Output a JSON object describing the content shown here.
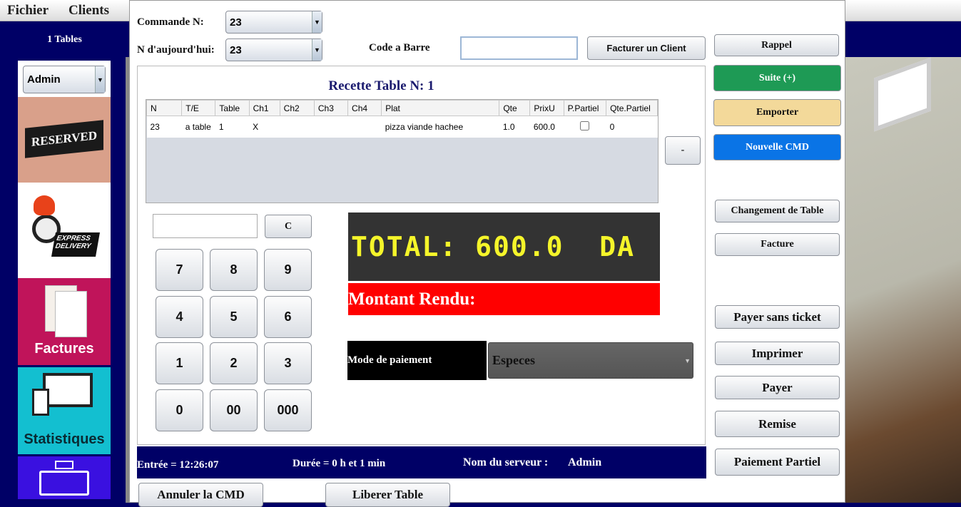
{
  "menu": {
    "items": [
      "Fichier",
      "Clients"
    ]
  },
  "sidebar": {
    "tables_label": "1 Tables",
    "user_select": "Admin",
    "tiles": [
      {
        "label": "RESERVED"
      },
      {
        "label": "EXPRESS DELIVERY"
      },
      {
        "label": "Factures"
      },
      {
        "label": "Statistiques"
      },
      {
        "label": ""
      }
    ]
  },
  "header": {
    "commande_label": "Commande N:",
    "commande_value": "23",
    "today_label": "N d'aujourd'hui:",
    "today_value": "23",
    "barcode_label": "Code a Barre",
    "barcode_value": "",
    "invoice_client": "Facturer un Client"
  },
  "recette": {
    "title": "Recette Table N: 1",
    "columns": [
      "N",
      "T/E",
      "Table",
      "Ch1",
      "Ch2",
      "Ch3",
      "Ch4",
      "Plat",
      "Qte",
      "PrixU",
      "P.Partiel",
      "Qte.Partiel"
    ],
    "rows": [
      {
        "n": "23",
        "te": "a table",
        "table": "1",
        "ch1": "X",
        "ch2": "",
        "ch3": "",
        "ch4": "",
        "plat": "pizza viande hachee",
        "qte": "1.0",
        "prixu": "600.0",
        "ppartiel": false,
        "qtepartiel": "0"
      }
    ],
    "minus": "-"
  },
  "keypad": {
    "input": "",
    "clear": "C",
    "keys": [
      "7",
      "8",
      "9",
      "4",
      "5",
      "6",
      "1",
      "2",
      "3",
      "0",
      "00",
      "000"
    ]
  },
  "total": {
    "text": "TOTAL: 600.0  DA",
    "color": "#f5f52a"
  },
  "rendu": {
    "text": "Montant Rendu:",
    "color": "#ff0000"
  },
  "payment": {
    "label": "Mode de paiement",
    "value": "Especes"
  },
  "footer": {
    "entree": "Entrée =  12:26:07",
    "duree": "Durée = 0 h  et 1 min",
    "serveur_label": "Nom du serveur :",
    "serveur": "Admin"
  },
  "bottom": {
    "annuler": "Annuler la CMD",
    "liberer": "Liberer Table"
  },
  "actions": {
    "rappel": "Rappel",
    "suite": "Suite (+)",
    "emporter": "Emporter",
    "nouvelle": "Nouvelle CMD",
    "changement": "Changement de Table",
    "facture": "Facture",
    "sans_ticket": "Payer sans ticket",
    "imprimer": "Imprimer",
    "payer": "Payer",
    "remise": "Remise",
    "partiel": "Paiement Partiel"
  },
  "colors": {
    "suite": "#1e9a55",
    "emporter": "#f3d99a",
    "nouvelle": "#0a74e6",
    "navy": "#000066"
  }
}
